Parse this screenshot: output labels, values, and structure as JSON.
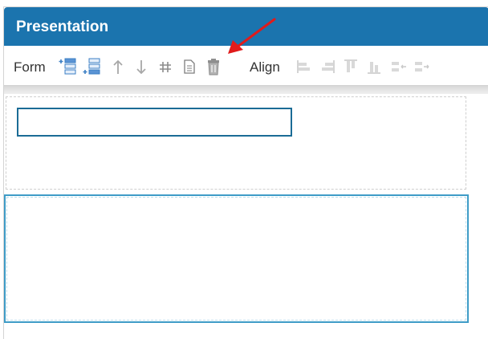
{
  "panel": {
    "title": "Presentation"
  },
  "toolbar": {
    "form_label": "Form",
    "align_label": "Align",
    "form_tools": [
      {
        "name": "insert-row-above-icon"
      },
      {
        "name": "insert-row-below-icon"
      },
      {
        "name": "move-up-icon"
      },
      {
        "name": "move-down-icon"
      },
      {
        "name": "grid-icon"
      },
      {
        "name": "document-icon"
      },
      {
        "name": "delete-icon"
      }
    ],
    "align_tools": [
      {
        "name": "align-left-icon"
      },
      {
        "name": "align-right-icon"
      },
      {
        "name": "align-top-icon"
      },
      {
        "name": "align-bottom-icon"
      },
      {
        "name": "align-distribute-left-icon"
      },
      {
        "name": "align-distribute-right-icon"
      }
    ]
  },
  "colors": {
    "header": "#1b74ae",
    "accent": "#3e9cc7",
    "icon_blue": "#3b7fc4",
    "icon_gray": "#a8a8a8",
    "arrow": "#e01b1b"
  }
}
